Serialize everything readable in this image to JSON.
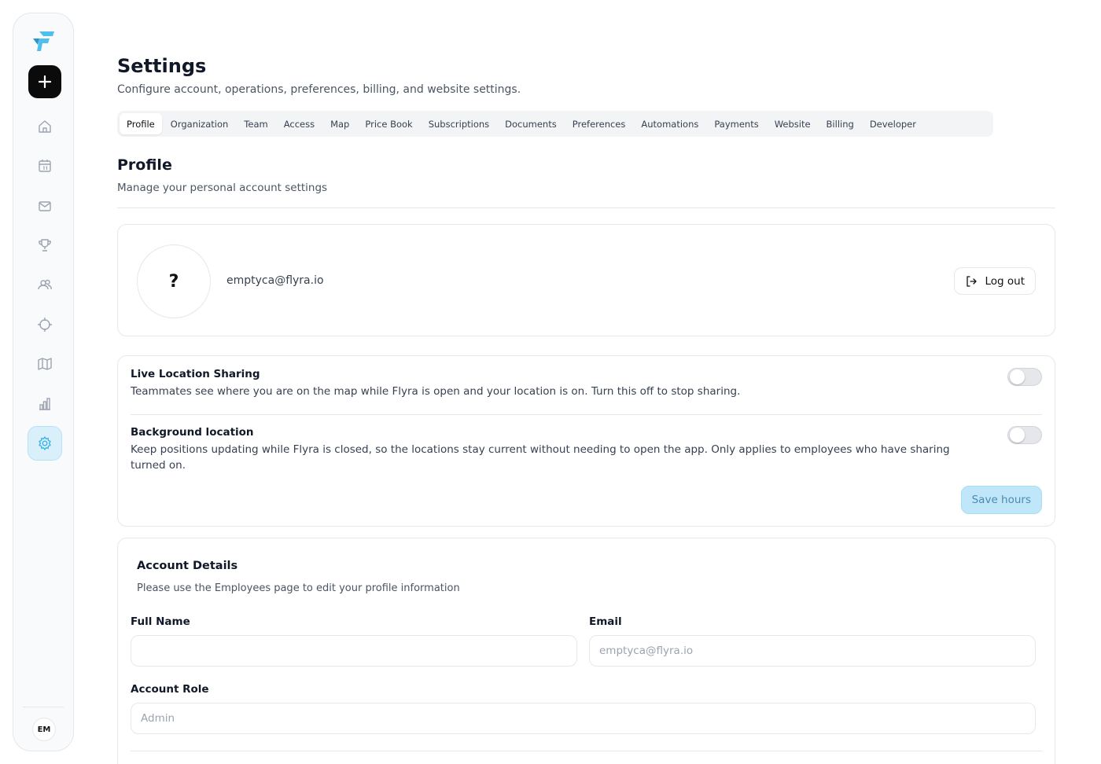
{
  "sidebar": {
    "logo": "flyra-logo",
    "new_button_icon": "plus-icon",
    "items": [
      {
        "name": "home",
        "icon": "home-icon",
        "active": false
      },
      {
        "name": "calendar",
        "icon": "calendar-icon",
        "active": false
      },
      {
        "name": "inbox",
        "icon": "mail-icon",
        "active": false
      },
      {
        "name": "achievements",
        "icon": "trophy-icon",
        "active": false
      },
      {
        "name": "team",
        "icon": "users-icon",
        "active": false
      },
      {
        "name": "tracking",
        "icon": "crosshair-icon",
        "active": false
      },
      {
        "name": "map",
        "icon": "map-icon",
        "active": false
      },
      {
        "name": "reports",
        "icon": "bar-chart-icon",
        "active": false
      },
      {
        "name": "settings",
        "icon": "gear-icon",
        "active": true
      }
    ],
    "user_initials": "EM"
  },
  "page": {
    "title": "Settings",
    "subtitle": "Configure account, operations, preferences, billing, and website settings."
  },
  "tabs": [
    {
      "label": "Profile",
      "active": true
    },
    {
      "label": "Organization",
      "active": false
    },
    {
      "label": "Team",
      "active": false
    },
    {
      "label": "Access",
      "active": false
    },
    {
      "label": "Map",
      "active": false
    },
    {
      "label": "Price Book",
      "active": false
    },
    {
      "label": "Subscriptions",
      "active": false
    },
    {
      "label": "Documents",
      "active": false
    },
    {
      "label": "Preferences",
      "active": false
    },
    {
      "label": "Automations",
      "active": false
    },
    {
      "label": "Payments",
      "active": false
    },
    {
      "label": "Website",
      "active": false
    },
    {
      "label": "Billing",
      "active": false
    },
    {
      "label": "Developer",
      "active": false
    }
  ],
  "profile": {
    "section_title": "Profile",
    "section_subtitle": "Manage your personal account settings",
    "avatar_text": "?",
    "email": "emptyca@flyra.io",
    "logout_label": "Log out"
  },
  "location": {
    "live": {
      "title": "Live Location Sharing",
      "description": "Teammates see where you are on the map while Flyra is open and your location is on. Turn this off to stop sharing.",
      "enabled": false
    },
    "background": {
      "title": "Background location",
      "description": "Keep positions updating while Flyra is closed, so the locations stay current without needing to open the app. Only applies to employees who have sharing turned on.",
      "enabled": false
    },
    "save_label": "Save hours"
  },
  "account": {
    "title": "Account Details",
    "subtitle": "Please use the Employees page to edit your profile information",
    "full_name_label": "Full Name",
    "full_name_value": "",
    "email_label": "Email",
    "email_placeholder": "emptyca@flyra.io",
    "role_label": "Account Role",
    "role_placeholder": "Admin"
  },
  "colors": {
    "accent": "#5bc4ef",
    "active_nav_bg": "#d9f0fb",
    "save_button_bg": "#bfe6f9"
  }
}
